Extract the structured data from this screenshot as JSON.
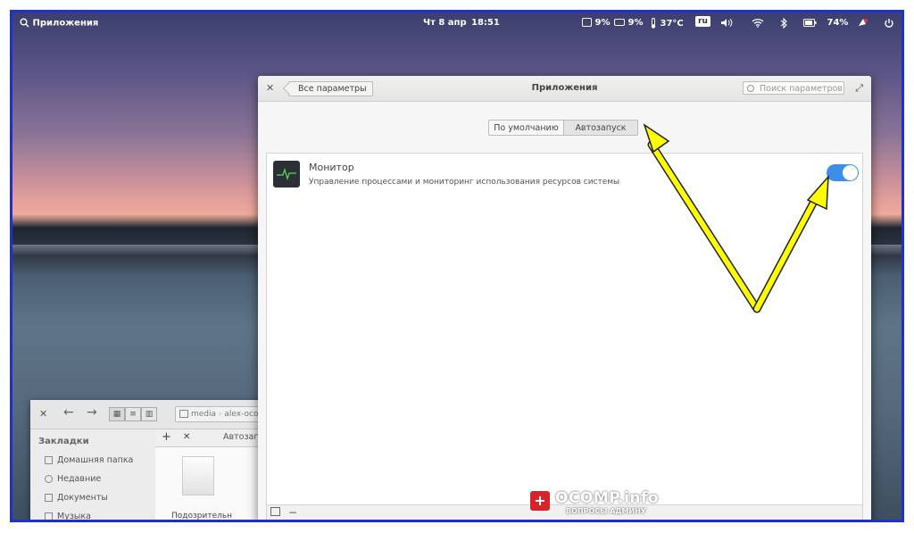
{
  "topbar": {
    "apps_label": "Приложения",
    "date": "Чт  8 апр",
    "time": "18:51",
    "cpu": "9%",
    "mem": "9%",
    "temp": "37°C",
    "lang": "ru",
    "battery": "74%"
  },
  "settings": {
    "back_label": "Все параметры",
    "title": "Приложения",
    "search_placeholder": "Поиск параметров",
    "tabs": [
      "По умолчанию",
      "Автозапуск"
    ],
    "app": {
      "name": "Монитор",
      "description": "Управление процессами и мониторинг использования ресурсов системы",
      "enabled": true
    },
    "footer_remove": "−"
  },
  "filemanager": {
    "path": [
      "media",
      "alex-oco"
    ],
    "tab_label": "Автозагр",
    "sidebar_title": "Закладки",
    "sidebar_items": [
      "Домашняя папка",
      "Недавние",
      "Документы",
      "Музыка"
    ],
    "file_label": "Подозрительн"
  },
  "watermark": {
    "title": "OCOMP.info",
    "subtitle": "ВОПРОСЫ АДМИНУ"
  },
  "colors": {
    "accent": "#3b8eea",
    "arrow": "#ffff00",
    "frame": "#1d2fd6"
  }
}
